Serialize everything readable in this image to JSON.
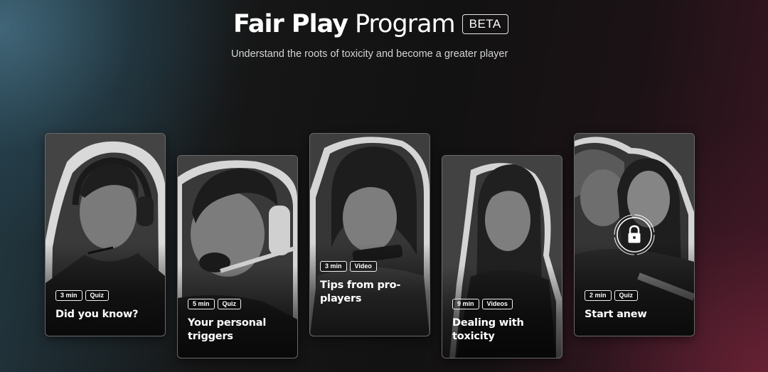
{
  "header": {
    "title_bold": "Fair Play",
    "title_light": "Program",
    "badge": "BETA",
    "subtitle": "Understand the roots of toxicity and become a greater player"
  },
  "cards": [
    {
      "duration": "3 min",
      "type": "Quiz",
      "title": "Did you know?",
      "locked": false
    },
    {
      "duration": "5 min",
      "type": "Quiz",
      "title": "Your personal triggers",
      "locked": false
    },
    {
      "duration": "3 min",
      "type": "Video",
      "title": "Tips from pro-players",
      "locked": false
    },
    {
      "duration": "9 min",
      "type": "Videos",
      "title": "Dealing with toxicity",
      "locked": false
    },
    {
      "duration": "2 min",
      "type": "Quiz",
      "title": "Start anew",
      "locked": true
    }
  ],
  "icons": {
    "lock": "lock-icon"
  },
  "colors": {
    "text": "#ffffff",
    "subtitle": "#d4d4d4",
    "card_border": "#6a6a6a"
  }
}
